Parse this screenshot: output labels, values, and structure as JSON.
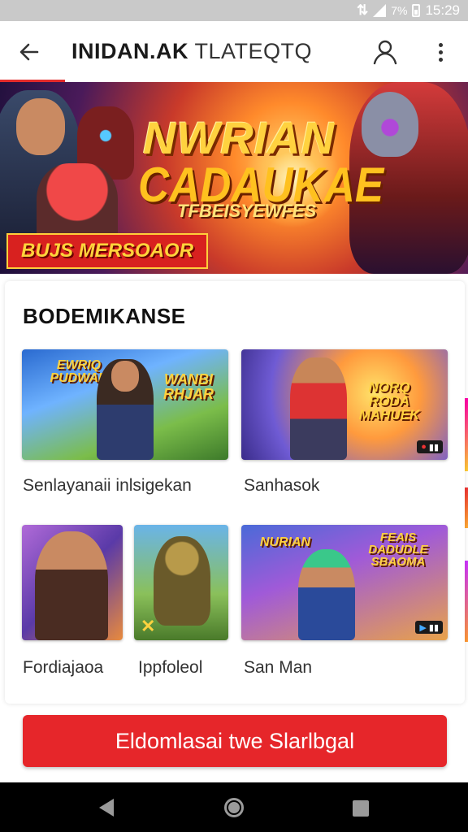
{
  "status_bar": {
    "battery_text": "7%",
    "time": "15:29"
  },
  "app_bar": {
    "title_bold": "INIDAN.AK",
    "title_light": "TLATEQTQ"
  },
  "banner": {
    "headline_1": "NWRIAN",
    "headline_2": "CADAUKAE",
    "subline": "TFBEISYEWFES",
    "tag": "BUJS MERSOAOR"
  },
  "section": {
    "title": "BODEMIKANSE",
    "items": [
      {
        "label": "Senlayanaii inlsigekan",
        "art_text": "EWRIQ PUDWAR"
      },
      {
        "label": "Sanhasok",
        "art_text": "NORQ RODA MAHUEK"
      },
      {
        "label": "Fordiajaoa",
        "art_text": ""
      },
      {
        "label": "Ippfoleol",
        "art_text": ""
      },
      {
        "label": "San Man",
        "art_text": "NURIAN"
      }
    ],
    "extra_art": {
      "thumb1_right": "WANBI RHJAR",
      "thumb5_right": "FEAIS DADUDLE SBAOMA"
    }
  },
  "cta": {
    "label": "Eldomlasai twe Slarlbgal"
  },
  "colors": {
    "accent_red": "#e6262a",
    "title_text": "#111111"
  }
}
